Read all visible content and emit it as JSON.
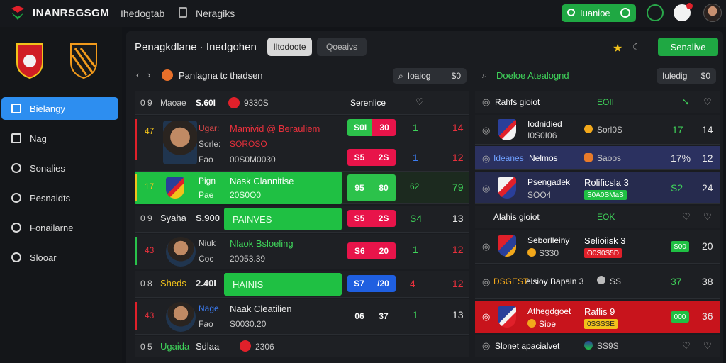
{
  "header": {
    "brand": "INANRSGSGM",
    "nav1": "Ihedogtab",
    "nav2": "Neragiks",
    "action_label": "Iuanioe"
  },
  "sidebar": {
    "items": [
      {
        "label": "Bielangy",
        "icon": "checkbox-icon",
        "active": true
      },
      {
        "label": "Nag",
        "icon": "square-icon",
        "active": false
      },
      {
        "label": "Sonalies",
        "icon": "minus-circle-icon",
        "active": false
      },
      {
        "label": "Pesnaidts",
        "icon": "pie-icon",
        "active": false
      },
      {
        "label": "Fonailarne",
        "icon": "gear-icon",
        "active": false
      },
      {
        "label": "Slooar",
        "icon": "clock-icon",
        "active": false
      }
    ]
  },
  "panel": {
    "title": "Penagkdlane · Inedgohen",
    "tab_a": "Iltodoote",
    "tab_b": "Qoeaivs",
    "cta": "Senalive"
  },
  "left": {
    "header_title": "Panlagna tc thadsen",
    "search": "Ioaiog",
    "search_val": "$0",
    "subheader": {
      "a": "0  9",
      "b": "Maoae",
      "c": "S.60I",
      "d": "9330S",
      "e": "Serenlice"
    },
    "rows": [
      {
        "rank": "47",
        "name": "Ugar:",
        "title": "Mamivid @ Berauliem",
        "sub1": "Sorle:",
        "sub1v": "SOROSO",
        "sub2": "Fao",
        "sub2v": "00S0M0030",
        "sb1a": "S0I",
        "sb1b": "30",
        "n1": "1",
        "n2": "14",
        "sb2a": "S5",
        "sb2b": "2S",
        "n3": "1",
        "n4": "12"
      },
      {
        "rank": "17",
        "name": "Pign",
        "title": "Nask Clannitise",
        "sub2": "Pae",
        "sub2v": "20S0O0",
        "sb1a": "95",
        "sb1b": "80",
        "n1": "62",
        "n2": "79"
      },
      {
        "rank": "0  9",
        "name": "Syaha",
        "val": "S.900",
        "block": "PAINVES",
        "sb1a": "S5",
        "sb1b": "2S",
        "n1": "S4",
        "n2": "13"
      },
      {
        "rank": "43",
        "name": "Niuk",
        "title": "Nlaok Bsloeling",
        "sub2": "Coc",
        "sub2v": "20053.39",
        "sb1a": "S6",
        "sb1b": "20",
        "n1": "1",
        "n2": "12"
      },
      {
        "rank": "0  8",
        "name": "Sheds",
        "val": "2.40I",
        "block": "HAINIS",
        "sb1a": "S7",
        "sb1b": "/20",
        "n1": "4",
        "n2": "12"
      },
      {
        "rank": "43",
        "name": "Nage",
        "title": "Naak Cleatilien",
        "sub2": "Fao",
        "sub2v": "S0030.20",
        "sb1a": "06",
        "sb1b": "37",
        "n1": "1",
        "n2": "13"
      },
      {
        "rank": "0  5",
        "name": "Ugaida",
        "val": "Sdlaa",
        "tag": "2306"
      }
    ]
  },
  "right": {
    "header_title": "Doeloe  Atealognd",
    "search": "Iuledig",
    "search_val": "$0",
    "rows": [
      {
        "title": "Rahfs  gioiot",
        "tag": "EOII"
      },
      {
        "line1": "Iodnidied",
        "line2": "I0S0I06",
        "sub": "Sorl0S",
        "n1": "17",
        "n2": "14"
      },
      {
        "left": "Ideanes",
        "mid": "Nelmos",
        "sub": "Saoos",
        "n1": "17%",
        "n2": "12"
      },
      {
        "line1": "Psengadek",
        "line2": "SOO4",
        "title": "Rolificsla 3",
        "tag": "S0A0SMaS",
        "n1": "S2",
        "n2": "24"
      },
      {
        "title": "Alahis  gioiot",
        "tag": "EOK"
      },
      {
        "line1": "Seborlleiny",
        "sub": "S330",
        "title": "Selioiisk 3",
        "tag": "O0S0S5D",
        "chip": "S00",
        "n2": "20"
      },
      {
        "left": "DSGEST",
        "title": "elsioy Bapaln 3",
        "sub": "SS",
        "n1": "37",
        "n2": "38"
      },
      {
        "line1": "Athegdgoet",
        "sub": "Sioe",
        "title": "Raflis 9",
        "tag": "0SSSSE",
        "chip": "000",
        "n2": "36"
      },
      {
        "title": "Slonet  apacialvet",
        "sub": "SS9S"
      }
    ]
  }
}
